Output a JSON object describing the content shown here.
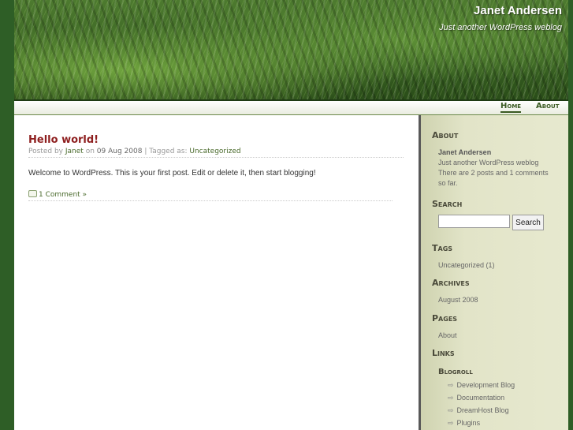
{
  "header": {
    "title": "Janet Andersen",
    "description": "Just another WordPress weblog"
  },
  "nav": {
    "items": [
      {
        "label": "Home",
        "active": true
      },
      {
        "label": "About",
        "active": false
      }
    ]
  },
  "post": {
    "title": "Hello world!",
    "meta_posted_by": "Posted by",
    "meta_author": "Janet",
    "meta_on": "on",
    "meta_date": "09 Aug 2008",
    "meta_tagged": "| Tagged as:",
    "meta_category": "Uncategorized",
    "body": "Welcome to WordPress. This is your first post. Edit or delete it, then start blogging!",
    "comments": "1 Comment »"
  },
  "sidebar": {
    "about_heading": "About",
    "about_name": "Janet Andersen",
    "about_desc": "Just another WordPress weblog",
    "about_stats_line1": "There are 2 posts and 1 comments",
    "about_stats_line2": "so far.",
    "search_heading": "Search",
    "search_button": "Search",
    "search_placeholder": "",
    "tags_heading": "Tags",
    "tags_item": "Uncategorized (1)",
    "archives_heading": "Archives",
    "archives_item": "August 2008",
    "pages_heading": "Pages",
    "pages_item": "About",
    "links_heading": "Links",
    "blogroll_heading": "Blogroll",
    "blogroll": [
      "Development Blog",
      "Documentation",
      "DreamHost Blog",
      "Plugins"
    ]
  },
  "icons": {
    "comment": "comment-bubble-icon",
    "arrow": "arrow-right-icon"
  },
  "colors": {
    "background": "#2e5e26",
    "post_title": "#8e1f1f",
    "link": "#4a6a2c"
  }
}
